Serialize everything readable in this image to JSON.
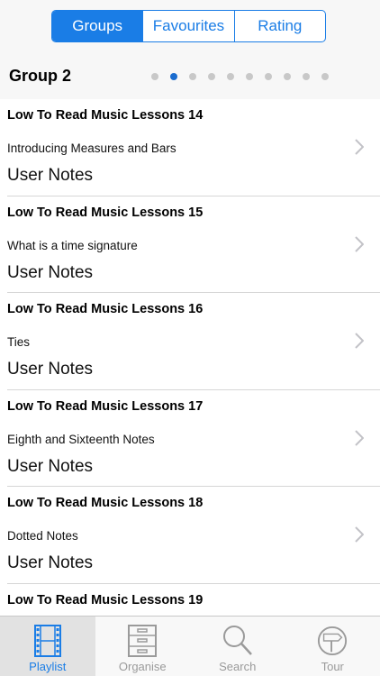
{
  "segments": [
    {
      "label": "Groups",
      "active": true
    },
    {
      "label": "Favourites",
      "active": false
    },
    {
      "label": "Rating",
      "active": false
    }
  ],
  "group": {
    "title": "Group 2",
    "page_count": 10,
    "current_page": 2
  },
  "items": [
    {
      "title": "Low To Read Music Lessons 14",
      "subtitle": "Introducing Measures and Bars",
      "notes": "User Notes"
    },
    {
      "title": "Low To Read Music Lessons 15",
      "subtitle": "What is a time signature",
      "notes": "User Notes"
    },
    {
      "title": "Low To Read Music Lessons 16",
      "subtitle": "Ties",
      "notes": "User Notes"
    },
    {
      "title": "Low To Read Music Lessons 17",
      "subtitle": "Eighth and Sixteenth Notes",
      "notes": "User Notes"
    },
    {
      "title": "Low To Read Music Lessons 18",
      "subtitle": "Dotted Notes",
      "notes": "User Notes"
    },
    {
      "title": "Low To Read Music Lessons 19",
      "subtitle": "",
      "notes": ""
    }
  ],
  "tabs": [
    {
      "label": "Playlist",
      "icon": "film-icon",
      "active": true
    },
    {
      "label": "Organise",
      "icon": "cabinet-icon",
      "active": false
    },
    {
      "label": "Search",
      "icon": "search-icon",
      "active": false
    },
    {
      "label": "Tour",
      "icon": "signpost-icon",
      "active": false
    }
  ],
  "colors": {
    "accent": "#1a7de6",
    "inactive": "#9a9a9a",
    "dot_inactive": "#c8c8c8",
    "dot_active": "#1a6ccf"
  }
}
